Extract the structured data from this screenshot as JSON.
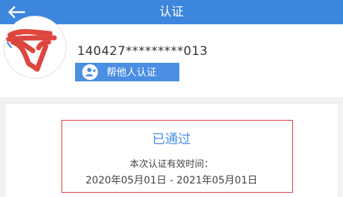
{
  "header": {
    "title": "认证",
    "back_icon": "arrow-left-icon",
    "background": "#3d86dd"
  },
  "profile": {
    "avatar_note": "redacted-avatar",
    "id_number": "140427*********013",
    "help_button": {
      "label": "帮他人认证",
      "icon": "person-add-icon"
    }
  },
  "result": {
    "status": "已通过",
    "validity_label": "本次认证有效时间：",
    "validity_range": "2020年05月01日 - 2021年05月01日",
    "status_color": "#4a8fe3",
    "highlight_color": "#e13a3a"
  }
}
